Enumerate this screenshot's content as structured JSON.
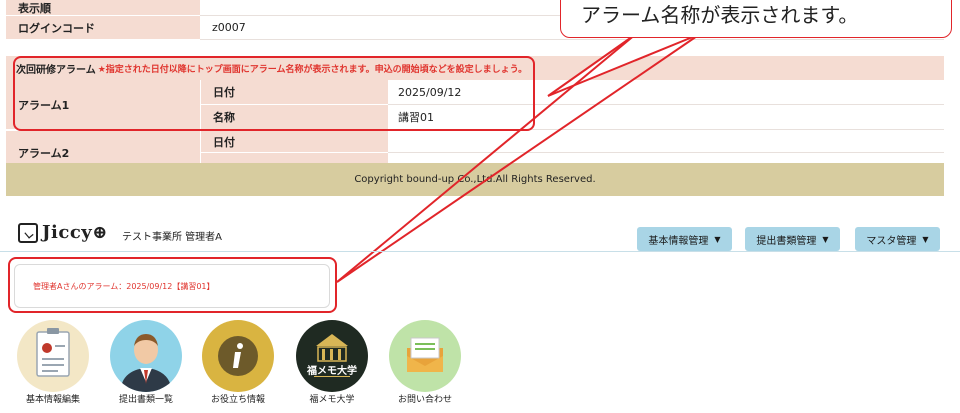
{
  "form": {
    "display_order_label": "表示順",
    "login_code_label": "ログインコード",
    "login_code_value": "z0007",
    "alarm_section_title": "次回研修アラーム",
    "alarm_section_note": "★指定された日付以降にトップ画面にアラーム名称が表示されます。申込の開始頃などを設定しましょう。",
    "alarm1_label": "アラーム1",
    "alarm2_label": "アラーム2",
    "date_label": "日付",
    "name_label": "名称",
    "alarm1_date": "2025/09/12",
    "alarm1_name": "講習01"
  },
  "footer": {
    "copyright": "Copyright bound-up Co.,Ltd.All Rights Reserved."
  },
  "callout": {
    "text": "アラーム名称が表示されます。"
  },
  "header": {
    "logo_text": "Jiccy",
    "logo_suffix": "⊕",
    "org": "テスト事業所 管理者A",
    "nav": [
      {
        "label": "基本情報管理"
      },
      {
        "label": "提出書類管理"
      },
      {
        "label": "マスタ管理"
      }
    ]
  },
  "alarm_message": "管理者Aさんのアラーム：2025/09/12【講習01】",
  "tiles": [
    {
      "label": "基本情報編集",
      "icon": "certificate-icon",
      "bg": "#f3e7c6"
    },
    {
      "label": "提出書類一覧",
      "icon": "user-icon",
      "bg": "#8fd3e8"
    },
    {
      "label": "お役立ち情報",
      "icon": "info-icon",
      "bg": "#d9b441"
    },
    {
      "label": "福メモ大学",
      "icon": "university-icon",
      "bg": "#1f2a22"
    },
    {
      "label": "お問い合わせ",
      "icon": "mail-icon",
      "bg": "#bfe3a8"
    }
  ],
  "tile_univ_text": "福メモ大学",
  "colors": {
    "accent_red": "#e1252a",
    "label_bg": "#f5dcd2",
    "footer_bg": "#d7cc9f",
    "nav_bg": "#a9d5e6"
  }
}
